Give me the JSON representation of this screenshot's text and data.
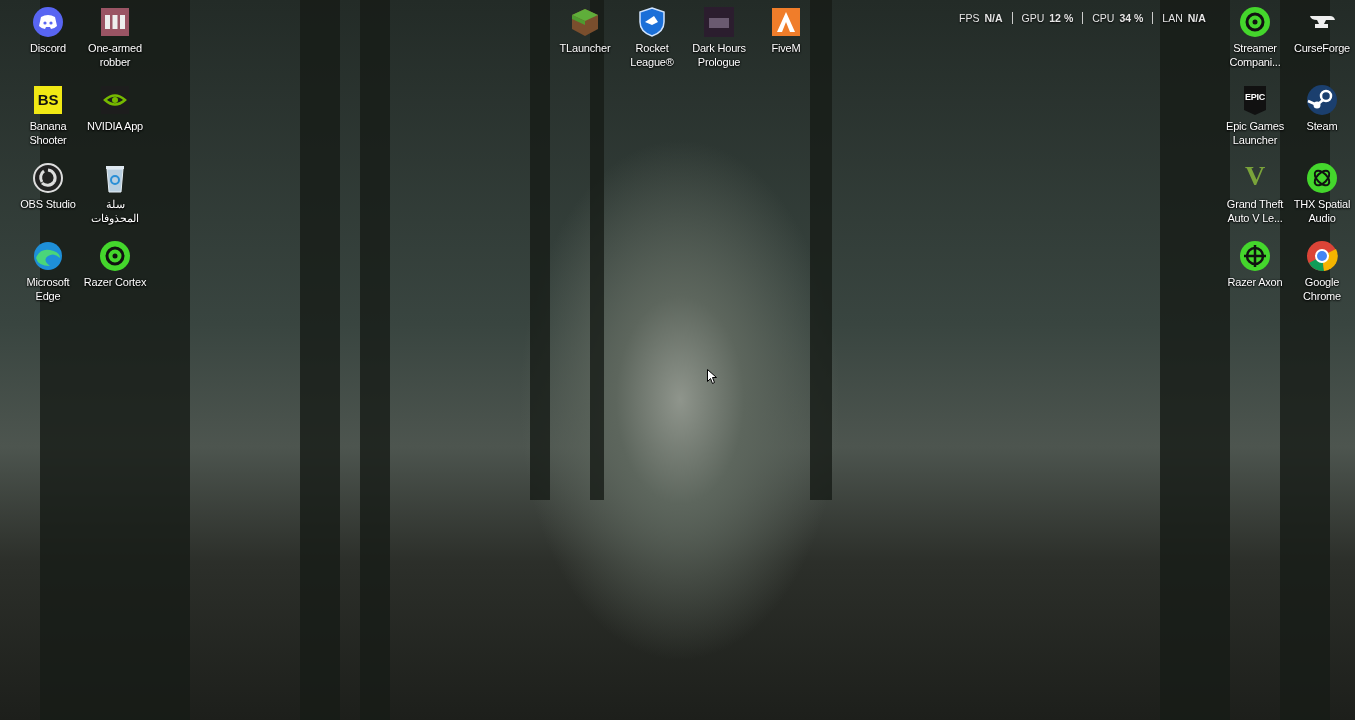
{
  "desktop": {
    "icon_groups": [
      {
        "kind": "left",
        "icons": [
          {
            "label": "Discord",
            "kind": "discord"
          },
          {
            "label": "Banana Shooter",
            "kind": "bs",
            "glyph": "BS"
          },
          {
            "label": "OBS Studio",
            "kind": "obs"
          },
          {
            "label": "Microsoft Edge",
            "kind": "edge"
          },
          {
            "label": "One-armed robber",
            "kind": "robber"
          },
          {
            "label": "NVIDIA App",
            "kind": "nvidia"
          },
          {
            "label": "سلة المحذوفات",
            "kind": "bin"
          },
          {
            "label": "Razer Cortex",
            "kind": "ring"
          }
        ]
      },
      {
        "kind": "top",
        "icons": [
          {
            "label": "TLauncher",
            "kind": "block"
          },
          {
            "label": "Rocket League®",
            "kind": "shield"
          },
          {
            "label": "Dark Hours Prologue",
            "kind": "poster"
          },
          {
            "label": "FiveM",
            "kind": "fivem"
          }
        ]
      },
      {
        "kind": "right",
        "icons": [
          {
            "label": "Streamer Compani...",
            "kind": "ring"
          },
          {
            "label": "Epic Games Launcher",
            "kind": "epic",
            "glyph": "EPIC"
          },
          {
            "label": "Grand Theft Auto V Le...",
            "kind": "vee",
            "glyph": "V"
          },
          {
            "label": "Razer Axon",
            "kind": "cross"
          },
          {
            "label": "CurseForge",
            "kind": "anvil"
          },
          {
            "label": "Steam",
            "kind": "steam"
          },
          {
            "label": "THX Spatial Audio",
            "kind": "knot"
          },
          {
            "label": "Google Chrome",
            "kind": "chrome"
          }
        ]
      }
    ]
  },
  "performance_overlay": {
    "stats": [
      {
        "label": "FPS",
        "value": "N/A"
      },
      {
        "label": "GPU",
        "value": "12 %"
      },
      {
        "label": "CPU",
        "value": "34 %"
      },
      {
        "label": "LAN",
        "value": "N/A"
      }
    ]
  }
}
